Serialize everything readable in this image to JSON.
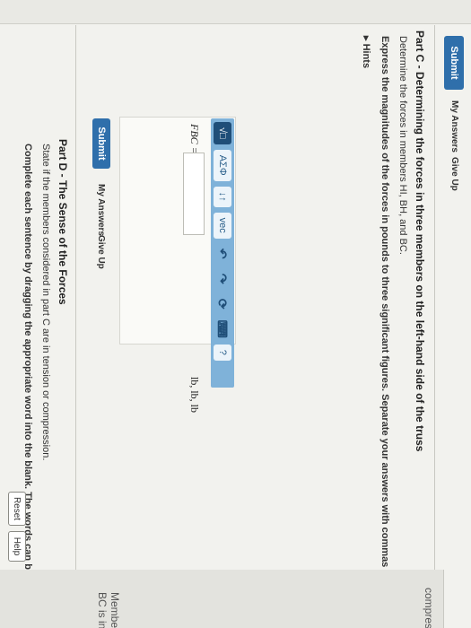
{
  "prev": {
    "submit_label": "Submit",
    "my_answers_label": "My Answers",
    "give_up_label": "Give Up"
  },
  "part_c": {
    "title": "Part C - Determining the forces in three members on the left-hand side of the truss",
    "instruction1": "Determine the forces in members HI, BH, and BC.",
    "instruction2": "Express the magnitudes of the forces in pounds to three significant figures. Separate your answers with commas",
    "hints_label": "Hints",
    "answer_label": "FBC =, FHI = FBH =",
    "answer_value": "",
    "units": "lb, lb, lb",
    "submit_label": "Submit",
    "my_answers_label": "My Answers",
    "give_up_label": "Give Up"
  },
  "toolbar": {
    "template_label": "√□",
    "greek_label": "AΣΦ",
    "arrows_label": "↓↑",
    "vec_label": "vec",
    "help_label": "?"
  },
  "part_d": {
    "title": "Part D - The Sense of the Forces",
    "instruction1": "State if the members considered in part C are in tension or compression.",
    "instruction2": "Complete each sentence by dragging the appropriate word into the blank. The words can be used more than o",
    "reset_label": "Reset",
    "help_label": "Help",
    "word_compression": "compression",
    "sentence_bc": "Member BC is in"
  },
  "colors": {
    "accent": "#2f6fab",
    "toolbar": "#7fb2d9",
    "background": "#f2f2ee"
  }
}
